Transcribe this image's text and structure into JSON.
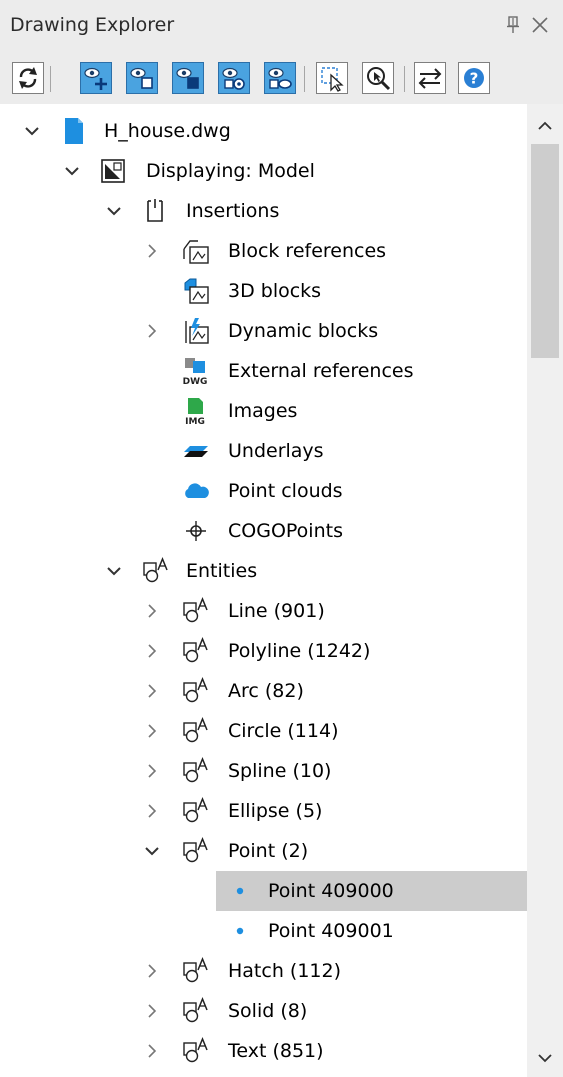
{
  "window": {
    "title": "Drawing Explorer",
    "pin_icon": "pin-icon",
    "close_icon": "close-icon"
  },
  "toolbar": {
    "buttons": [
      {
        "icon": "refresh-icon"
      },
      {
        "icon": "eye-add-icon"
      },
      {
        "icon": "eye-hide-icon"
      },
      {
        "icon": "eye-isolate-icon"
      },
      {
        "icon": "eye-settings-icon"
      },
      {
        "icon": "eye-search-icon"
      },
      {
        "icon": "select-objects-icon"
      },
      {
        "icon": "zoom-to-icon"
      },
      {
        "icon": "swap-arrows-icon"
      },
      {
        "icon": "help-icon"
      }
    ],
    "accent": "#4aa3e0"
  },
  "tree": {
    "selected_color": "#cccccc",
    "rows": [
      {
        "label": "H_house.dwg",
        "icon": "dwg-file-icon",
        "expand": "expanded"
      },
      {
        "label": "Displaying: Model",
        "icon": "model-space-icon",
        "expand": "expanded"
      },
      {
        "label": "Insertions",
        "icon": "insertions-icon",
        "expand": "expanded"
      },
      {
        "label": "Block references",
        "icon": "block-reference-icon",
        "expand": "collapsed"
      },
      {
        "label": "3D blocks",
        "icon": "3d-block-icon",
        "expand": "none"
      },
      {
        "label": "Dynamic blocks",
        "icon": "dynamic-block-icon",
        "expand": "collapsed"
      },
      {
        "label": "External references",
        "icon": "xref-dwg-icon",
        "expand": "none"
      },
      {
        "label": "Images",
        "icon": "image-file-icon",
        "expand": "none"
      },
      {
        "label": "Underlays",
        "icon": "underlay-icon",
        "expand": "none"
      },
      {
        "label": "Point clouds",
        "icon": "cloud-icon",
        "expand": "none"
      },
      {
        "label": "COGOPoints",
        "icon": "cogo-point-icon",
        "expand": "none"
      },
      {
        "label": "Entities",
        "icon": "entities-icon",
        "expand": "expanded"
      },
      {
        "label": "Line (901)",
        "icon": "entities-icon",
        "expand": "collapsed"
      },
      {
        "label": "Polyline (1242)",
        "icon": "entities-icon",
        "expand": "collapsed"
      },
      {
        "label": "Arc (82)",
        "icon": "entities-icon",
        "expand": "collapsed"
      },
      {
        "label": "Circle (114)",
        "icon": "entities-icon",
        "expand": "collapsed"
      },
      {
        "label": "Spline (10)",
        "icon": "entities-icon",
        "expand": "collapsed"
      },
      {
        "label": "Ellipse (5)",
        "icon": "entities-icon",
        "expand": "collapsed"
      },
      {
        "label": "Point (2)",
        "icon": "entities-icon",
        "expand": "expanded"
      },
      {
        "label": "Point 409000",
        "icon": "point-dot-icon",
        "expand": "none",
        "selected": true
      },
      {
        "label": "Point 409001",
        "icon": "point-dot-icon",
        "expand": "none"
      },
      {
        "label": "Hatch (112)",
        "icon": "entities-icon",
        "expand": "collapsed"
      },
      {
        "label": "Solid (8)",
        "icon": "entities-icon",
        "expand": "collapsed"
      },
      {
        "label": "Text (851)",
        "icon": "entities-icon",
        "expand": "collapsed"
      }
    ]
  },
  "scrollbar": {
    "up_icon": "scroll-up-icon",
    "down_icon": "scroll-down-icon"
  }
}
